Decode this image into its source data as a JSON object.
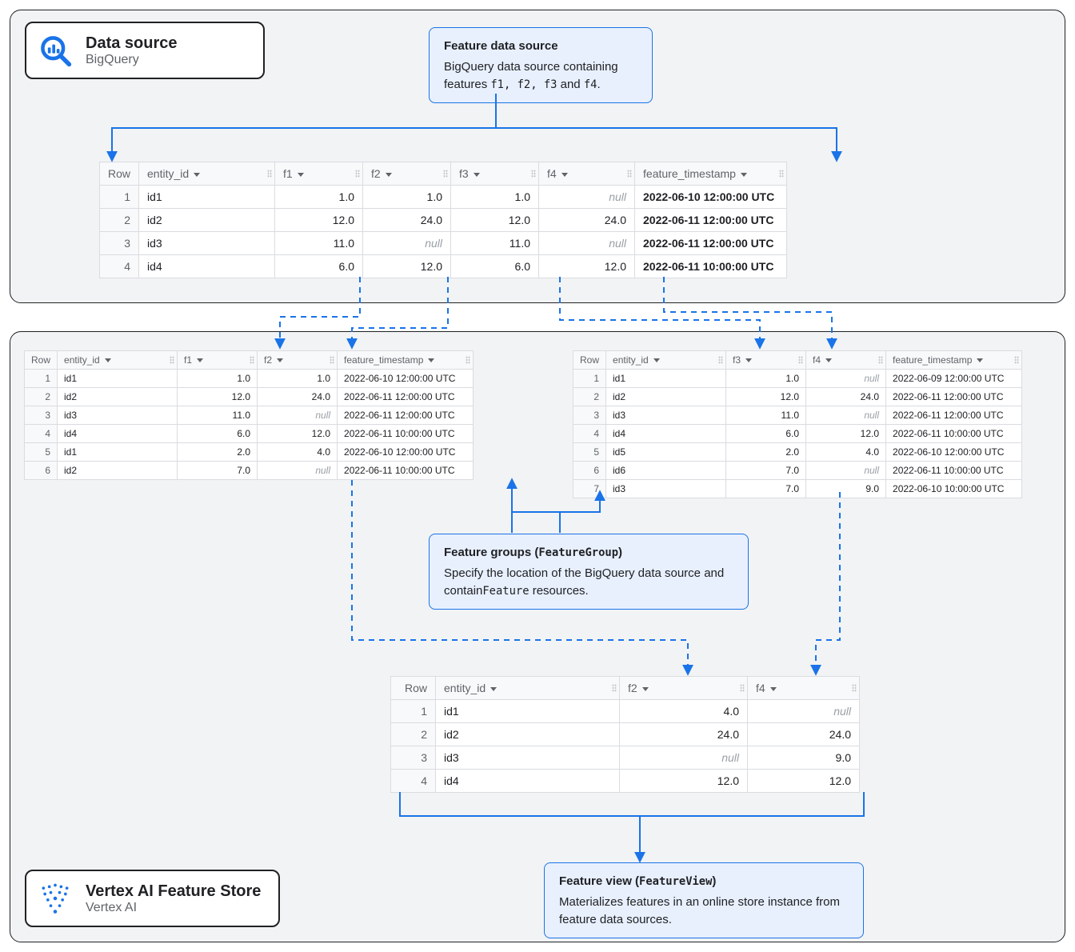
{
  "colors": {
    "accent": "#1a73e8"
  },
  "top_label": {
    "title": "Data source",
    "sub": "BigQuery"
  },
  "bottom_label": {
    "title": "Vertex AI Feature Store",
    "sub": "Vertex AI"
  },
  "callout_source": {
    "hd": "Feature data source",
    "body_pre": "BigQuery data source containing features ",
    "code": "f1, f2, f3",
    "body_post": " and ",
    "code2": "f4",
    "tail": "."
  },
  "callout_groups": {
    "hd_pre": "Feature groups (",
    "hd_code": "FeatureGroup",
    "hd_post": ")",
    "body_pre": "Specify the location of the BigQuery data source and contain",
    "code": "Feature",
    "body_post": " resources."
  },
  "callout_view": {
    "hd_pre": "Feature view (",
    "hd_code": "FeatureView",
    "hd_post": ")",
    "body": "Materializes features in an online store instance from feature data sources."
  },
  "tbl_src": {
    "headers": [
      "Row",
      "entity_id",
      "f1",
      "f2",
      "f3",
      "f4",
      "feature_timestamp"
    ],
    "rows": [
      [
        "1",
        "id1",
        "1.0",
        "1.0",
        "1.0",
        "null",
        "2022-06-10 12:00:00 UTC"
      ],
      [
        "2",
        "id2",
        "12.0",
        "24.0",
        "12.0",
        "24.0",
        "2022-06-11 12:00:00 UTC"
      ],
      [
        "3",
        "id3",
        "11.0",
        "null",
        "11.0",
        "null",
        "2022-06-11 12:00:00 UTC"
      ],
      [
        "4",
        "id4",
        "6.0",
        "12.0",
        "6.0",
        "12.0",
        "2022-06-11 10:00:00 UTC"
      ]
    ]
  },
  "tbl_g1": {
    "headers": [
      "Row",
      "entity_id",
      "f1",
      "f2",
      "feature_timestamp"
    ],
    "rows": [
      [
        "1",
        "id1",
        "1.0",
        "1.0",
        "2022-06-10 12:00:00 UTC"
      ],
      [
        "2",
        "id2",
        "12.0",
        "24.0",
        "2022-06-11 12:00:00 UTC"
      ],
      [
        "3",
        "id3",
        "11.0",
        "null",
        "2022-06-11 12:00:00 UTC"
      ],
      [
        "4",
        "id4",
        "6.0",
        "12.0",
        "2022-06-11 10:00:00 UTC"
      ],
      [
        "5",
        "id1",
        "2.0",
        "4.0",
        "2022-06-10 12:00:00 UTC"
      ],
      [
        "6",
        "id2",
        "7.0",
        "null",
        "2022-06-11 10:00:00 UTC"
      ]
    ]
  },
  "tbl_g2": {
    "headers": [
      "Row",
      "entity_id",
      "f3",
      "f4",
      "feature_timestamp"
    ],
    "rows": [
      [
        "1",
        "id1",
        "1.0",
        "null",
        "2022-06-09 12:00:00 UTC"
      ],
      [
        "2",
        "id2",
        "12.0",
        "24.0",
        "2022-06-11 12:00:00 UTC"
      ],
      [
        "3",
        "id3",
        "11.0",
        "null",
        "2022-06-11 12:00:00 UTC"
      ],
      [
        "4",
        "id4",
        "6.0",
        "12.0",
        "2022-06-11 10:00:00 UTC"
      ],
      [
        "5",
        "id5",
        "2.0",
        "4.0",
        "2022-06-10 12:00:00 UTC"
      ],
      [
        "6",
        "id6",
        "7.0",
        "null",
        "2022-06-11 10:00:00 UTC"
      ],
      [
        "7",
        "id3",
        "7.0",
        "9.0",
        "2022-06-10 10:00:00 UTC"
      ]
    ]
  },
  "tbl_view": {
    "headers": [
      "Row",
      "entity_id",
      "f2",
      "f4"
    ],
    "rows": [
      [
        "1",
        "id1",
        "4.0",
        "null"
      ],
      [
        "2",
        "id2",
        "24.0",
        "24.0"
      ],
      [
        "3",
        "id3",
        "null",
        "9.0"
      ],
      [
        "4",
        "id4",
        "12.0",
        "12.0"
      ]
    ]
  }
}
